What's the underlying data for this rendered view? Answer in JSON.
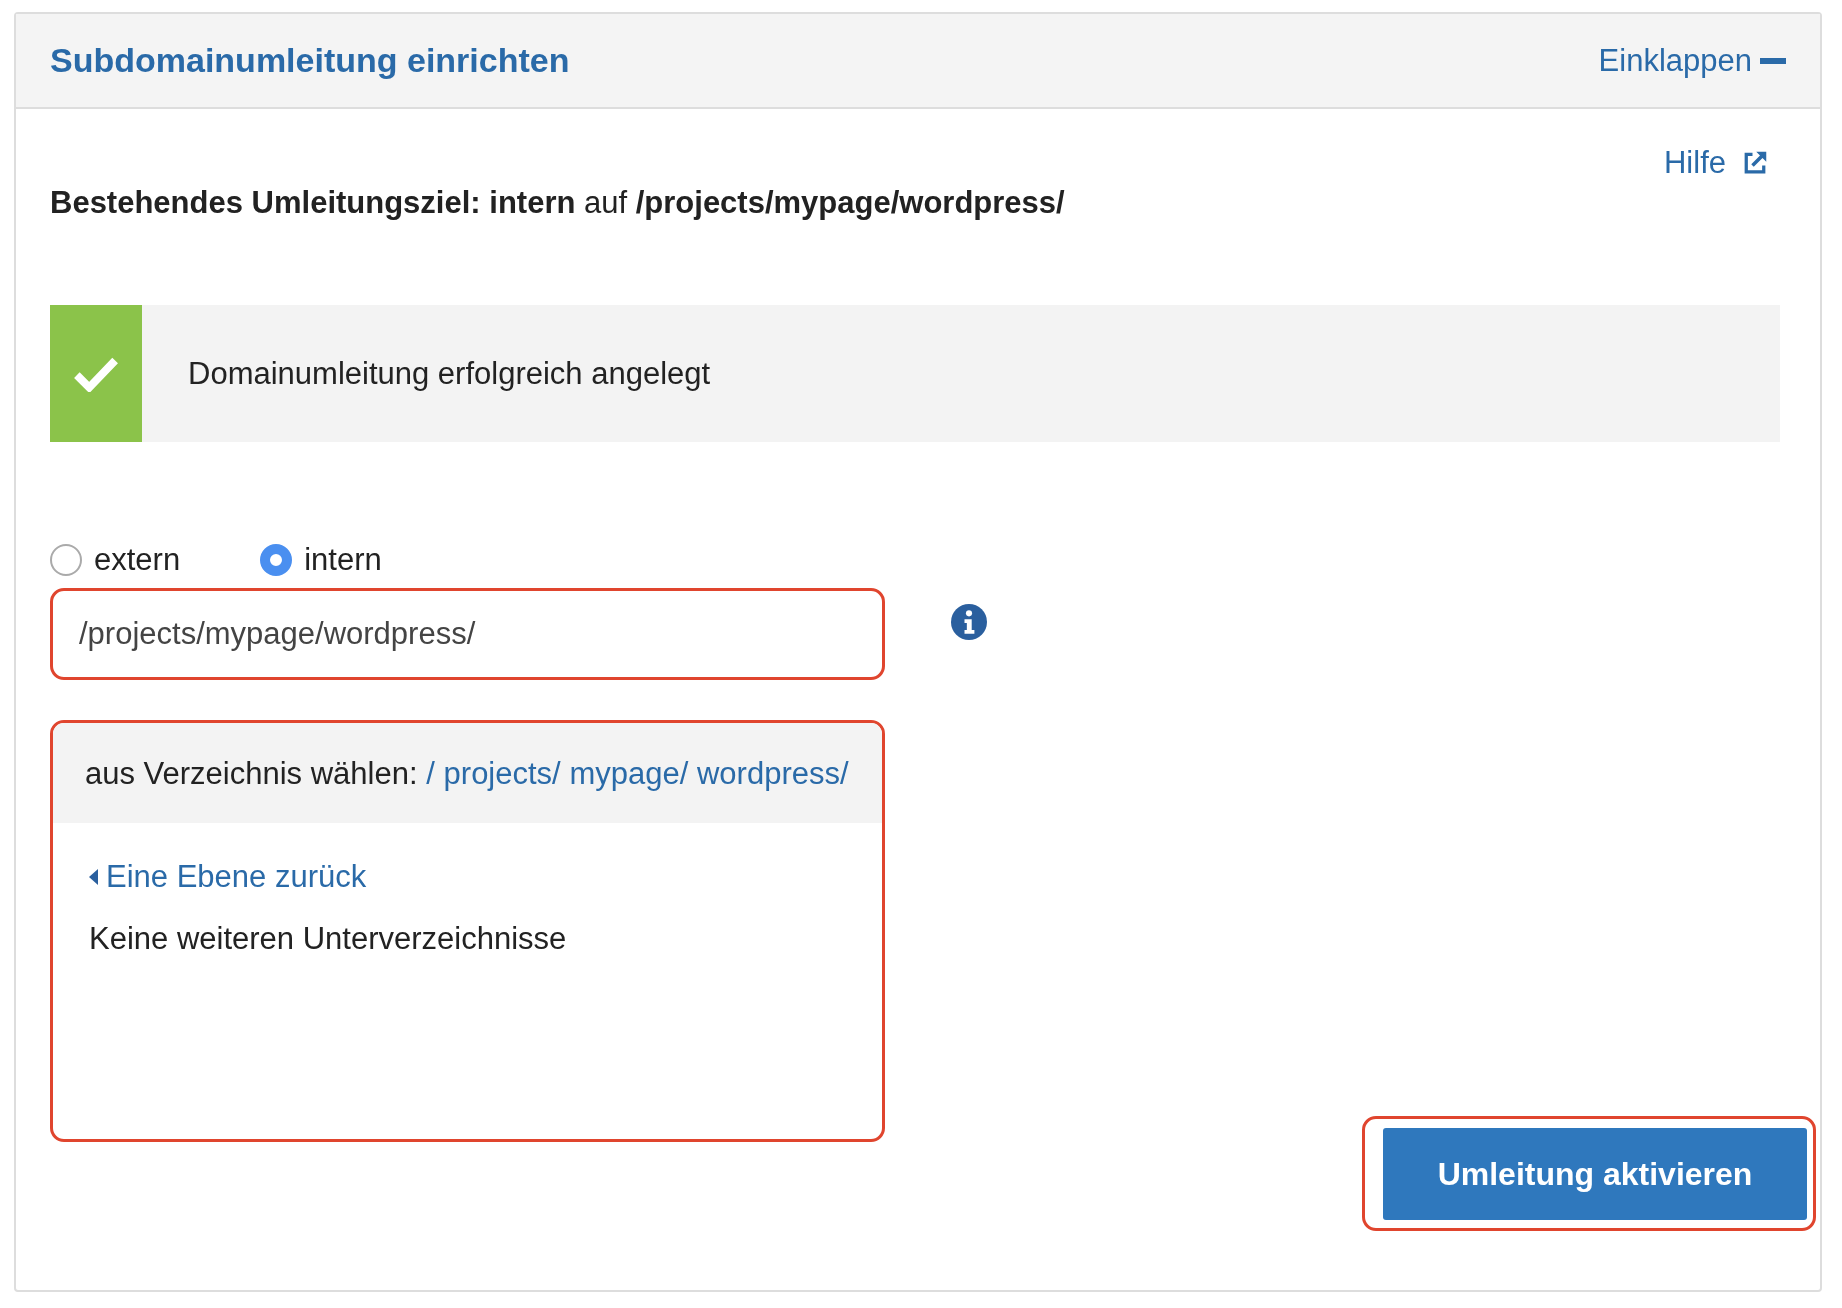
{
  "panel": {
    "title": "Subdomainumleitung einrichten",
    "collapse_link": "Einklappen"
  },
  "help_link": "Hilfe",
  "current_target": "**Bestehendes Umleitungsziel: intern** auf **/projects/mypage/wordpress/**",
  "alert": {
    "message": "Domainumleitung erfolgreich angelegt"
  },
  "target_types": [
    {
      "label": "extern",
      "selected": false
    },
    {
      "label": "intern",
      "selected": true
    }
  ],
  "path_field": {
    "value": "/projects/mypage/wordpress/"
  },
  "directory_browser": {
    "label": "aus Verzeichnis wählen:",
    "breadcrumbs": [
      "/",
      "projects/",
      "mypage/",
      "wordpress/"
    ],
    "back_link": "Eine Ebene zurück",
    "empty_message": "Keine weiteren Unterverzeichnisse"
  },
  "submit_button": "Umleitung aktivieren"
}
